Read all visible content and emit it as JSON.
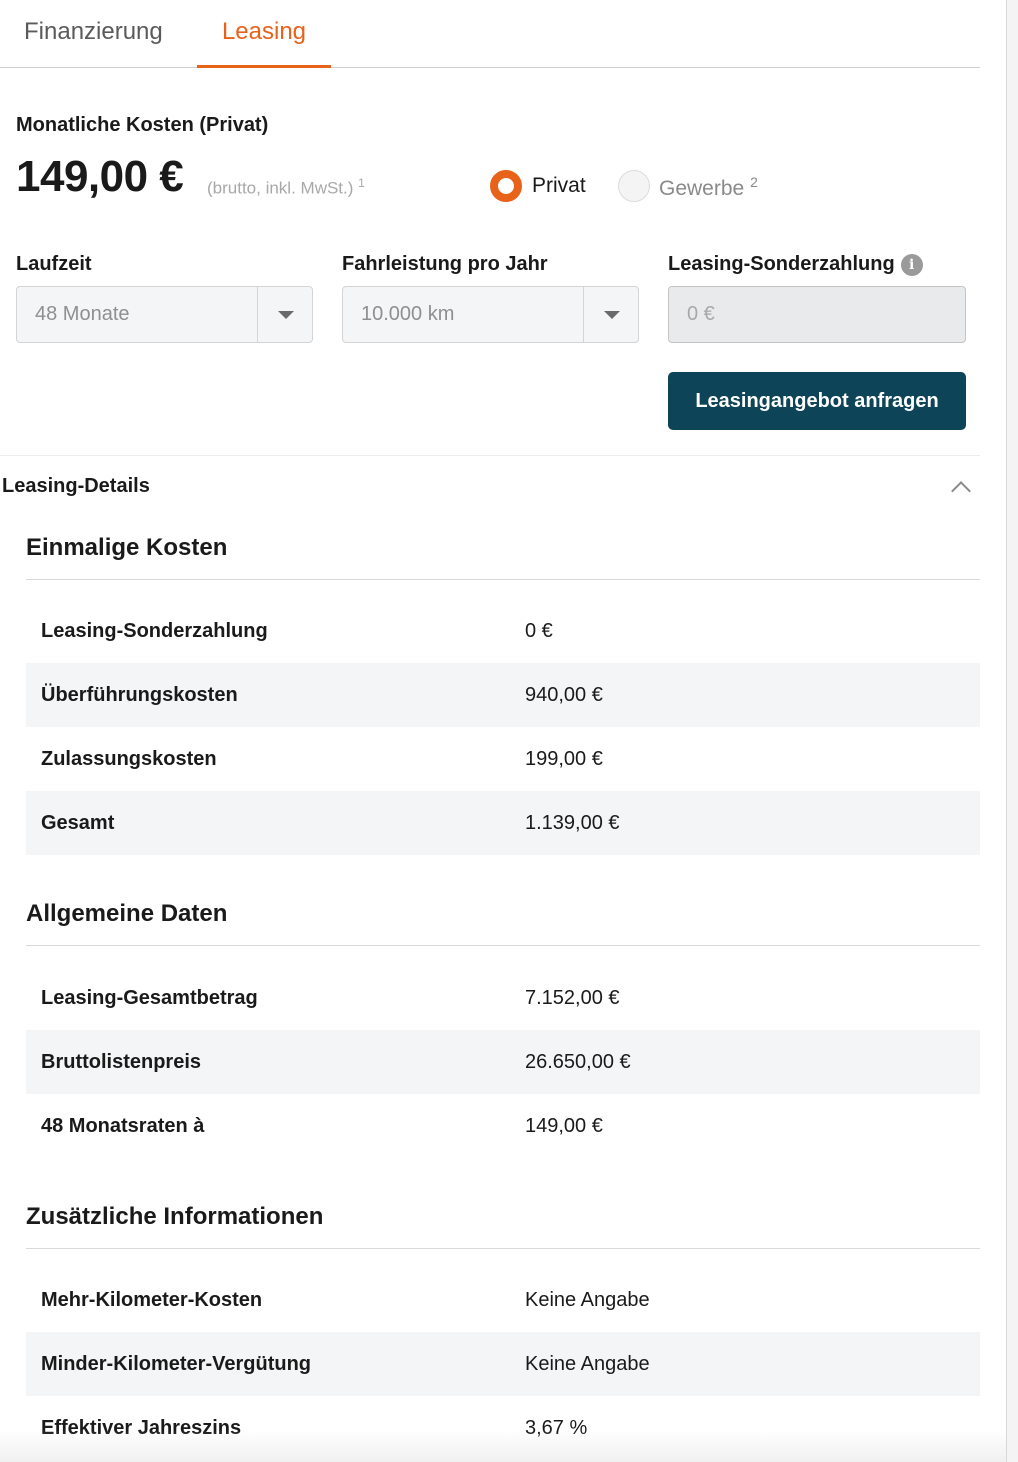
{
  "tabs": [
    {
      "label": "Finanzierung",
      "active": false
    },
    {
      "label": "Leasing",
      "active": true
    }
  ],
  "accent_color": "#e8621a",
  "button_color": "#0e4457",
  "summary": {
    "title": "Monatliche Kosten (Privat)",
    "price": "149,00 €",
    "price_note": "(brutto, inkl. MwSt.)",
    "price_note_ref": "1"
  },
  "customer_type": {
    "selected": "Privat",
    "options": [
      {
        "label": "Privat",
        "ref": ""
      },
      {
        "label": "Gewerbe",
        "ref": "2"
      }
    ]
  },
  "fields": {
    "laufzeit": {
      "label": "Laufzeit",
      "value": "48 Monate"
    },
    "fahrleistung": {
      "label": "Fahrleistung pro Jahr",
      "value": "10.000 km"
    },
    "sonderzahlung": {
      "label": "Leasing-Sonderzahlung",
      "value": "0 €",
      "info_icon": "info-icon"
    }
  },
  "cta_label": "Leasingangebot anfragen",
  "details": {
    "title": "Leasing-Details",
    "toggle_icon": "chevron-up-icon",
    "sections": [
      {
        "title": "Einmalige Kosten",
        "rows": [
          {
            "label": "Leasing-Sonderzahlung",
            "value": "0 €"
          },
          {
            "label": "Überführungskosten",
            "value": "940,00 €"
          },
          {
            "label": "Zulassungskosten",
            "value": "199,00 €"
          },
          {
            "label": "Gesamt",
            "value": "1.139,00 €"
          }
        ]
      },
      {
        "title": "Allgemeine Daten",
        "rows": [
          {
            "label": "Leasing-Gesamtbetrag",
            "value": "7.152,00 €"
          },
          {
            "label": "Bruttolistenpreis",
            "value": "26.650,00 €"
          },
          {
            "label": "48 Monatsraten à",
            "value": "149,00 €"
          }
        ]
      },
      {
        "title": "Zusätzliche Informationen",
        "rows": [
          {
            "label": "Mehr-Kilometer-Kosten",
            "value": "Keine Angabe"
          },
          {
            "label": "Minder-Kilometer-Vergütung",
            "value": "Keine Angabe"
          },
          {
            "label": "Effektiver Jahreszins",
            "value": "3,67 %"
          }
        ]
      }
    ]
  }
}
